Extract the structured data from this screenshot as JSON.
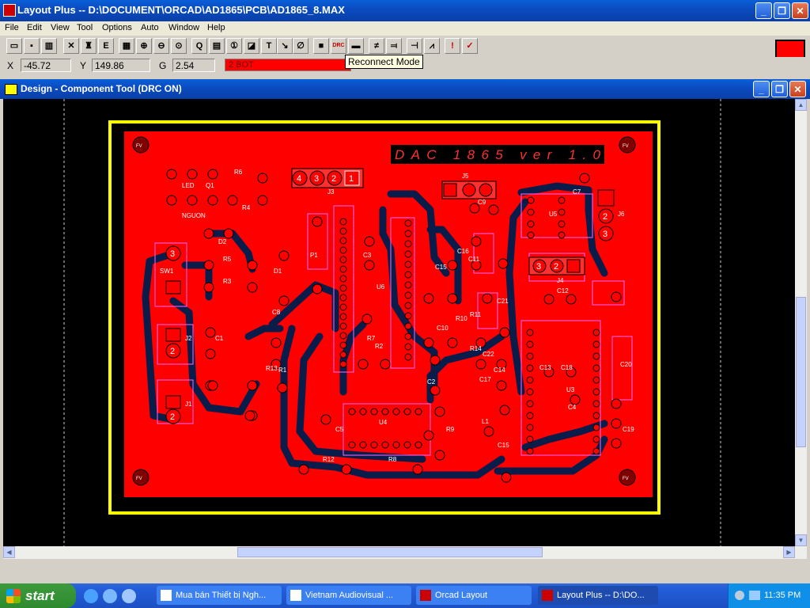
{
  "titlebar": {
    "title": "Layout Plus -- D:\\DOCUMENT\\ORCAD\\AD1865\\PCB\\AD1865_8.MAX"
  },
  "menu": {
    "items": [
      "File",
      "Edit",
      "View",
      "Tool",
      "Options",
      "Auto",
      "Window",
      "Help"
    ]
  },
  "toolbar": {
    "tooltip": "Reconnect Mode",
    "drc_label": "DRC"
  },
  "coords": {
    "x_label": "X",
    "x_value": "-45.72",
    "y_label": "Y",
    "y_value": "149.86",
    "g_label": "G",
    "g_value": "2.54",
    "layer": "2 BOT"
  },
  "design_window": {
    "title": "Design - Component Tool (DRC ON)"
  },
  "pcb": {
    "board_title": "DAC 1865 ver 1.0",
    "labels": [
      "R6",
      "Q1",
      "R4",
      "LED",
      "NGUON",
      "D2",
      "R5",
      "R3",
      "SW1",
      "J2",
      "C1",
      "J1",
      "R13",
      "D1",
      "R1",
      "P1",
      "C8",
      "C6",
      "J3",
      "J5",
      "C9",
      "C3",
      "U6",
      "C15",
      "C16",
      "C11",
      "R2",
      "C10",
      "C12",
      "R10",
      "R11",
      "R7",
      "R14",
      "C21",
      "C22",
      "C14",
      "C17",
      "C7",
      "J6",
      "U5",
      "J4",
      "C13",
      "C18",
      "C19",
      "C20",
      "U3",
      "C4",
      "U4",
      "C5",
      "C2",
      "R9",
      "L1",
      "C15",
      "R12",
      "R8",
      "FV"
    ],
    "pads": [
      "4",
      "3",
      "2",
      "1",
      "3",
      "2",
      "2",
      "2",
      "3",
      "2",
      "1",
      "2",
      "1",
      "2",
      "3",
      "1",
      "2"
    ],
    "mounting_hole": "FV"
  },
  "taskbar": {
    "start": "start",
    "tasks": [
      "Mua bán Thiết bị Ngh...",
      "Vietnam Audiovisual ...",
      "Orcad Layout",
      "Layout Plus -- D:\\DO..."
    ],
    "clock": "11:35 PM"
  },
  "colors": {
    "board": "#ff0000",
    "outline": "#ffff00",
    "trace": "#0a1d4a",
    "title_bg": "#0b4cc1"
  }
}
